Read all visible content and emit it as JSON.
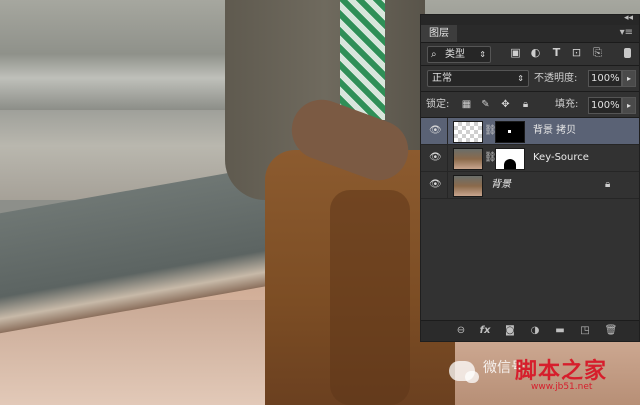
{
  "panel": {
    "collapse_arrows": "◂◂",
    "tab_label": "图层",
    "menu_icon": "menu-icon",
    "filter": {
      "label": "类型",
      "icon": "search-icon"
    },
    "filter_icons": [
      "image-filter-icon",
      "adjustment-filter-icon",
      "type-filter-icon",
      "shape-filter-icon",
      "smart-object-filter-icon"
    ],
    "blend_mode": "正常",
    "opacity_label": "不透明度:",
    "opacity_value": "100%",
    "lock_label": "锁定:",
    "fill_label": "填充:",
    "fill_value": "100%",
    "layers": [
      {
        "name": "背景 拷贝",
        "selected": true
      },
      {
        "name": "Key-Source",
        "selected": false
      },
      {
        "name": "背景",
        "selected": false,
        "locked": true
      }
    ],
    "footer_icons": [
      "link-icon",
      "fx-icon",
      "mask-icon",
      "adjustment-icon",
      "folder-icon",
      "new-layer-icon",
      "trash-icon"
    ]
  },
  "watermark": {
    "text": "微信号",
    "brand": "脚本之家",
    "url": "www.jb51.net"
  }
}
